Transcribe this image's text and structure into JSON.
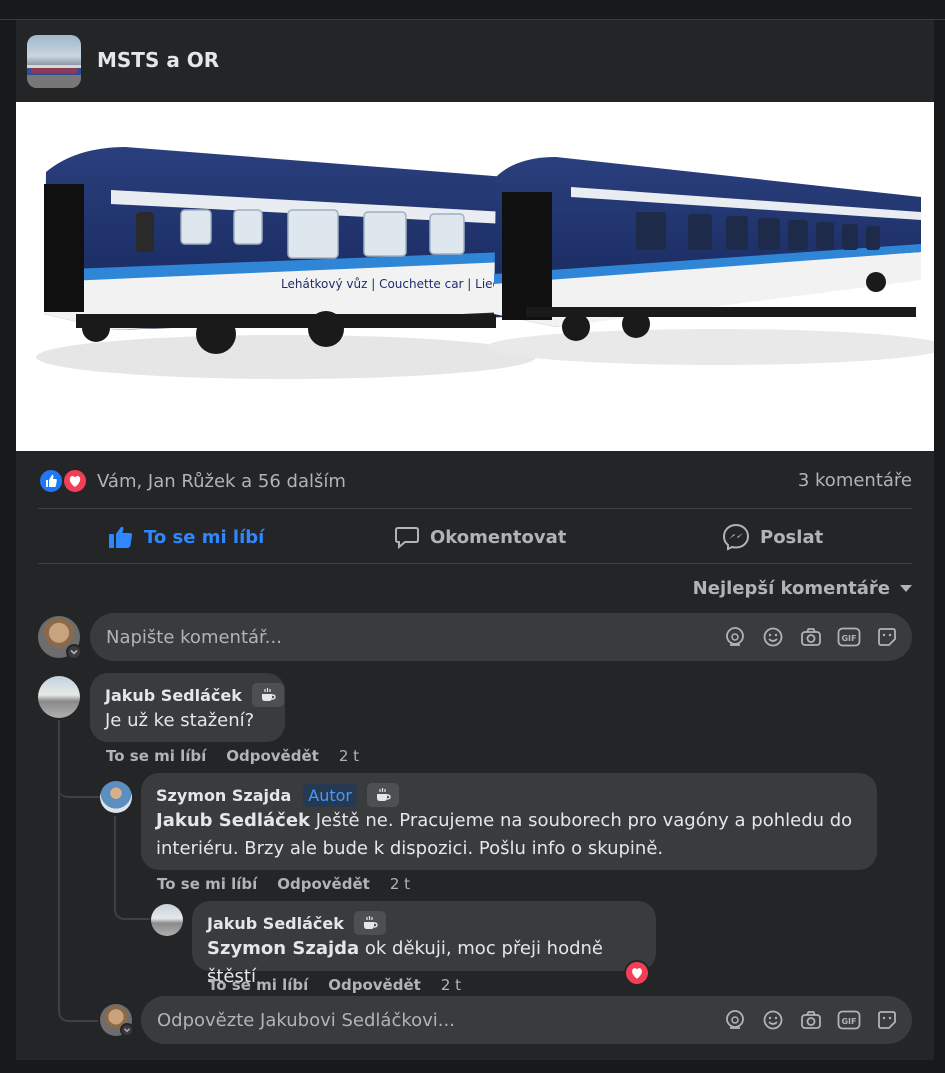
{
  "post": {
    "page_name": "MSTS a OR",
    "photo_alt": "",
    "coach_text": "Lehátkový vůz | Couchette car | Liegewagen"
  },
  "stats": {
    "reactions_text": "Vám, Jan Růžek a 56 dalším",
    "comments_count": "3 komentáře"
  },
  "actions": {
    "like": "To se mi líbí",
    "comment": "Okomentovat",
    "send": "Poslat"
  },
  "sort_label": "Nejlepší komentáře",
  "comment_input": {
    "placeholder": "Napište komentář..."
  },
  "comments": [
    {
      "author": "Jakub Sedláček",
      "text": "Je už ke stažení?",
      "like": "To se mi líbí",
      "reply": "Odpovědět",
      "time": "2 t"
    },
    {
      "author": "Szymon Szajda",
      "badge": "Autor",
      "mention": "Jakub Sedláček",
      "text_line1": " Ještě ne. Pracujeme na souborech pro vagóny a pohledu do",
      "text_line2": "interiéru. Brzy ale bude k dispozici. Pošlu info o skupině.",
      "like": "To se mi líbí",
      "reply": "Odpovědět",
      "time": "2 t"
    },
    {
      "author": "Jakub Sedláček",
      "mention": "Szymon Szajda",
      "text": " ok děkuji, moc přeji hodně štěstí",
      "like": "To se mi líbí",
      "reply": "Odpovědět",
      "time": "2 t"
    }
  ],
  "reply_input": {
    "placeholder": "Odpovězte Jakubovi Sedláčkovi..."
  },
  "colors": {
    "accent": "#2d88ff",
    "love": "#f33e58",
    "coach_blue": "#1d2f6b"
  }
}
